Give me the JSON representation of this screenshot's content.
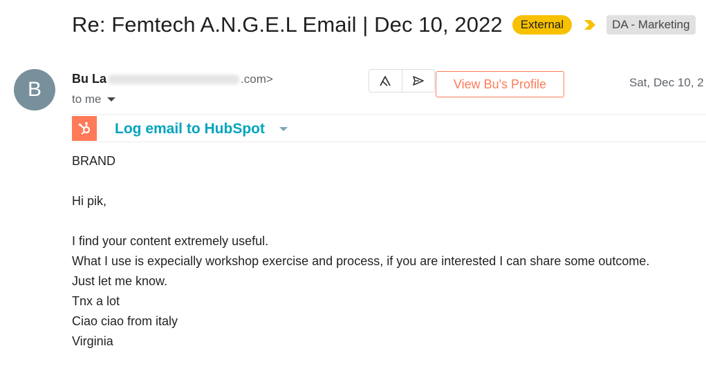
{
  "email": {
    "subject": "Re: Femtech A.N.G.E.L Email | Dec 10, 2022",
    "badge_external": "External",
    "label": "DA - Marketing",
    "avatar_letter": "B",
    "sender_name": "Bu La",
    "sender_email_suffix": ".com>",
    "to_me": "to me",
    "date": "Sat, Dec 10, 2",
    "view_profile_label": "View Bu's Profile",
    "hubspot_label": "Log email to HubSpot"
  },
  "body": {
    "line1": "BRAND",
    "line2": "Hi pik,",
    "line3": "I find your content extremely useful.",
    "line4": "What I use is expecially workshop exercise and process, if you are interested I can share some outcome.",
    "line5": "Just let me know.",
    "line6": "Tnx a lot",
    "line7": "Ciao ciao from italy",
    "line8": "Virginia"
  },
  "colors": {
    "external_badge": "#f7c100",
    "hubspot_orange": "#ff7a59",
    "hubspot_teal": "#00a4bd",
    "avatar_bg": "#78909c"
  },
  "icons": [
    "label-arrow-icon",
    "reply-tool-icon",
    "send-icon",
    "hubspot-logo-icon",
    "chevron-down-icon"
  ]
}
